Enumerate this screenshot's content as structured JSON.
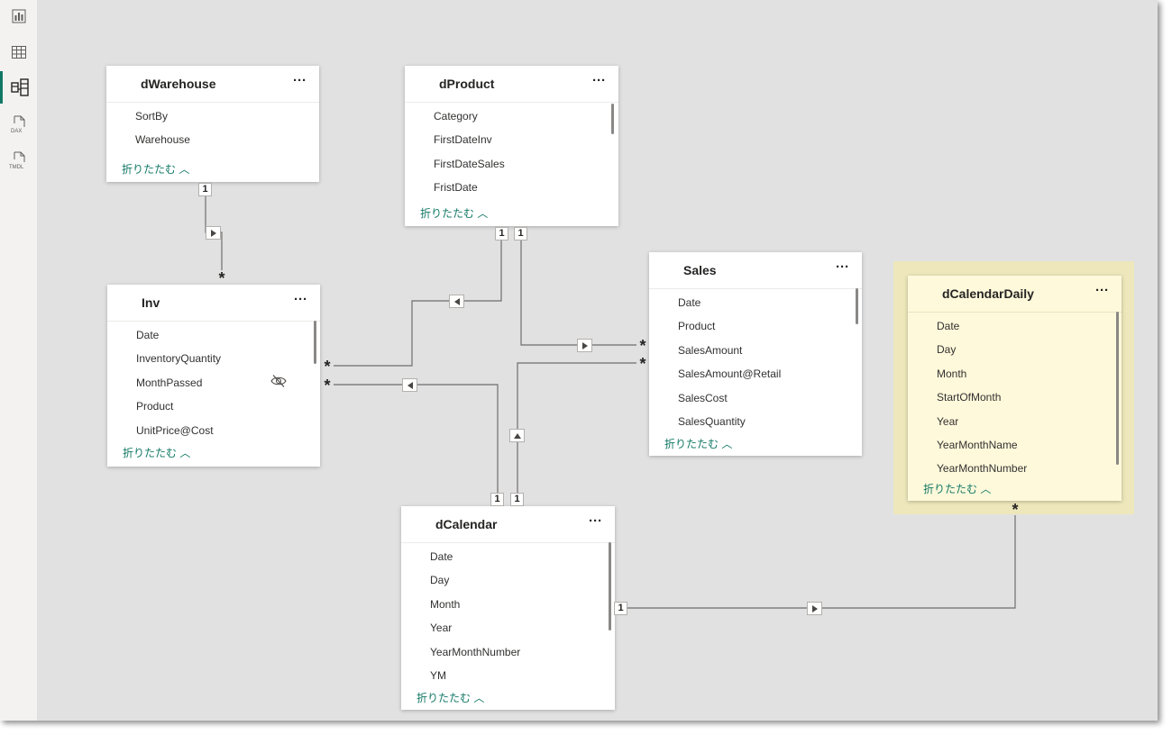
{
  "rail": {
    "items": [
      {
        "name": "report-view",
        "active": false
      },
      {
        "name": "table-view",
        "active": false
      },
      {
        "name": "model-view",
        "active": true
      },
      {
        "name": "dax-query-view",
        "label": "DAX",
        "active": false
      },
      {
        "name": "tmdl-view",
        "label": "TMDL",
        "active": false
      }
    ]
  },
  "tables": {
    "dWarehouse": {
      "title": "dWarehouse",
      "more": "···",
      "fields": [
        "SortBy",
        "Warehouse"
      ],
      "collapse": "折りたたむ ︿"
    },
    "dProduct": {
      "title": "dProduct",
      "more": "···",
      "fields": [
        "Category",
        "FirstDateInv",
        "FirstDateSales",
        "FristDate"
      ],
      "collapse": "折りたたむ ︿"
    },
    "Inv": {
      "title": "Inv",
      "more": "···",
      "fields": [
        "Date",
        "InventoryQuantity",
        "MonthPassed",
        "Product",
        "UnitPrice@Cost"
      ],
      "collapse": "折りたたむ ︿"
    },
    "Sales": {
      "title": "Sales",
      "more": "···",
      "fields": [
        "Date",
        "Product",
        "SalesAmount",
        "SalesAmount@Retail",
        "SalesCost",
        "SalesQuantity"
      ],
      "collapse": "折りたたむ ︿"
    },
    "dCalendar": {
      "title": "dCalendar",
      "more": "···",
      "fields": [
        "Date",
        "Day",
        "Month",
        "Year",
        "YearMonthNumber",
        "YM"
      ],
      "collapse": "折りたたむ ︿"
    },
    "dCalendarDaily": {
      "title": "dCalendarDaily",
      "more": "···",
      "fields": [
        "Date",
        "Day",
        "Month",
        "StartOfMonth",
        "Year",
        "YearMonthName",
        "YearMonthNumber"
      ],
      "collapse": "折りたたむ ︿"
    }
  },
  "cardinality": {
    "one": "1",
    "many": "*"
  },
  "colors": {
    "accent": "#117865",
    "highlight": "#efe7b4",
    "canvas": "#e1e1e1",
    "wire": "#6e6e6e"
  }
}
